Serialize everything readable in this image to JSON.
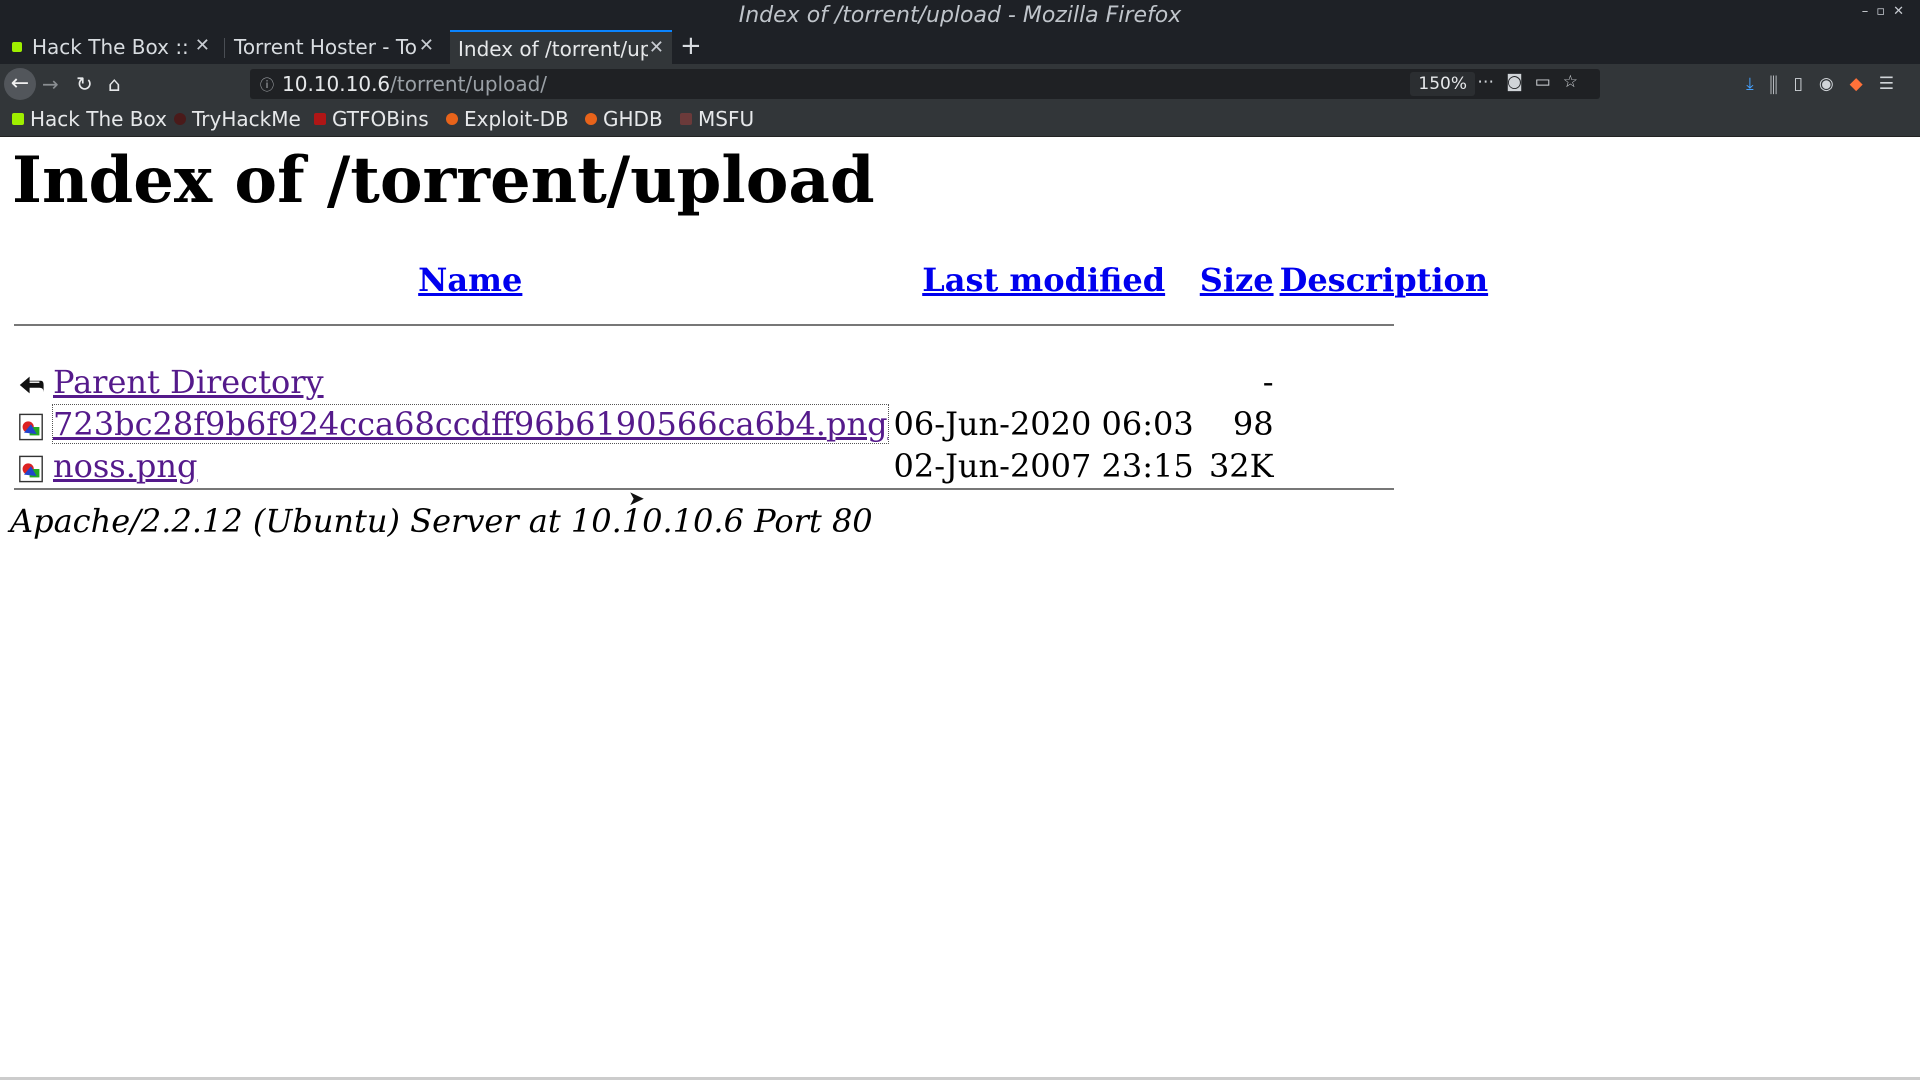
{
  "window": {
    "title": "Index of /torrent/upload - Mozilla Firefox"
  },
  "tabs": [
    {
      "label": "Hack The Box :: M"
    },
    {
      "label": "Torrent Hoster - To"
    },
    {
      "label": "Index of /torrent/up"
    }
  ],
  "address": {
    "host": "10.10.10.6",
    "path": "/torrent/upload/",
    "zoom": "150%"
  },
  "bookmarks": [
    "Hack The Box",
    "TryHackMe",
    "GTFOBins",
    "Exploit-DB",
    "GHDB",
    "MSFU"
  ],
  "page": {
    "heading": "Index of /torrent/upload",
    "columns": {
      "name": "Name",
      "modified": "Last modified",
      "size": "Size",
      "description": "Description"
    },
    "rows": [
      {
        "name": "Parent Directory",
        "modified": "",
        "size": "-",
        "icon": "back-arrow-icon"
      },
      {
        "name": "723bc28f9b6f924cca68ccdff96b6190566ca6b4.png",
        "modified": "06-Jun-2020 06:03",
        "size": "98",
        "icon": "image-file-icon"
      },
      {
        "name": "noss.png",
        "modified": "02-Jun-2007 23:15",
        "size": "32K",
        "icon": "image-file-icon"
      }
    ],
    "footer": "Apache/2.2.12 (Ubuntu) Server at 10.10.10.6 Port 80"
  },
  "colors": {
    "link": "#0000ee",
    "visited": "#551a8b",
    "chrome": "#323639",
    "titlebar": "#1e2126",
    "accent": "#0a84ff"
  }
}
